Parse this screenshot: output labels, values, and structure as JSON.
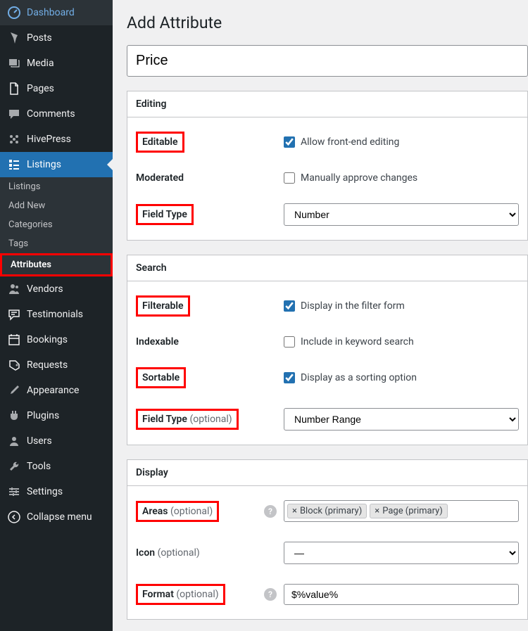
{
  "sidebar": {
    "items": [
      {
        "label": "Dashboard",
        "icon": "dashboard"
      },
      {
        "label": "Posts",
        "icon": "posts"
      },
      {
        "label": "Media",
        "icon": "media"
      },
      {
        "label": "Pages",
        "icon": "pages"
      },
      {
        "label": "Comments",
        "icon": "comments"
      },
      {
        "label": "HivePress",
        "icon": "hivepress"
      },
      {
        "label": "Listings",
        "icon": "listings",
        "active": true
      },
      {
        "label": "Vendors",
        "icon": "vendors"
      },
      {
        "label": "Testimonials",
        "icon": "testimonials"
      },
      {
        "label": "Bookings",
        "icon": "bookings"
      },
      {
        "label": "Requests",
        "icon": "requests"
      },
      {
        "label": "Appearance",
        "icon": "appearance"
      },
      {
        "label": "Plugins",
        "icon": "plugins"
      },
      {
        "label": "Users",
        "icon": "users"
      },
      {
        "label": "Tools",
        "icon": "tools"
      },
      {
        "label": "Settings",
        "icon": "settings"
      },
      {
        "label": "Collapse menu",
        "icon": "collapse"
      }
    ],
    "sub": [
      "Listings",
      "Add New",
      "Categories",
      "Tags",
      "Attributes"
    ]
  },
  "page": {
    "title": "Add Attribute",
    "name_value": "Price"
  },
  "sections": {
    "editing": {
      "title": "Editing",
      "editable": {
        "label": "Editable",
        "checkbox": "Allow front-end editing",
        "checked": true
      },
      "moderated": {
        "label": "Moderated",
        "checkbox": "Manually approve changes",
        "checked": false
      },
      "fieldType": {
        "label": "Field Type",
        "value": "Number"
      }
    },
    "search": {
      "title": "Search",
      "filterable": {
        "label": "Filterable",
        "checkbox": "Display in the filter form",
        "checked": true
      },
      "indexable": {
        "label": "Indexable",
        "checkbox": "Include in keyword search",
        "checked": false
      },
      "sortable": {
        "label": "Sortable",
        "checkbox": "Display as a sorting option",
        "checked": true
      },
      "fieldType": {
        "label": "Field Type",
        "optional": "(optional)",
        "value": "Number Range"
      }
    },
    "display": {
      "title": "Display",
      "areas": {
        "label": "Areas",
        "optional": "(optional)",
        "tokens": [
          "Block (primary)",
          "Page (primary)"
        ]
      },
      "icon": {
        "label": "Icon",
        "optional": "(optional)",
        "value": "—"
      },
      "format": {
        "label": "Format",
        "optional": "(optional)",
        "value": "$%value%"
      }
    }
  }
}
